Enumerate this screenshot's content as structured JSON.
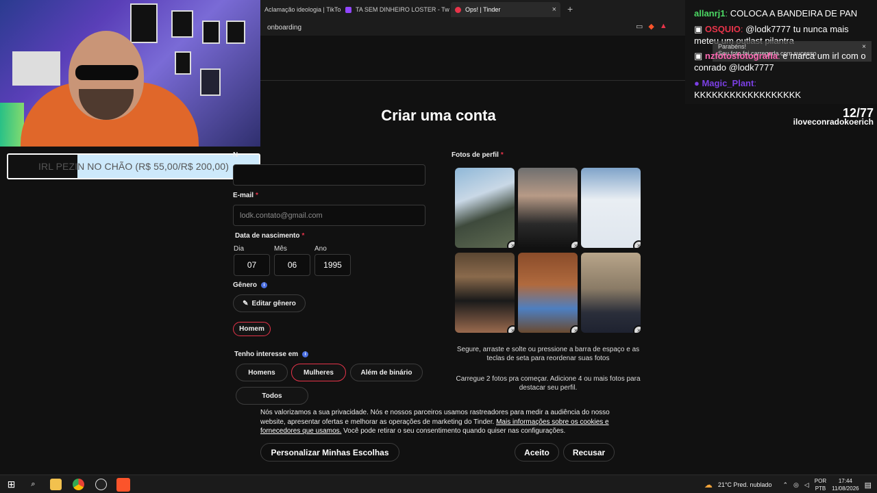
{
  "browser": {
    "tabs": [
      {
        "label": "Aclamação ideologia | TikTok",
        "color": "#ffffff",
        "active": false
      },
      {
        "label": "TA SEM DINHEIRO LOSTER - Twitch",
        "color": "#9146ff",
        "active": false
      },
      {
        "label": "Ops! | Tinder",
        "color": "#e8344a",
        "active": true
      }
    ],
    "new_tab_symbol": "+",
    "close_symbol": "×",
    "address": "onboarding"
  },
  "alert": {
    "text": "IRL PEZIN NO CHÃO (R$ 55,00/R$ 200,00)",
    "progress": 0.275,
    "fill_color": "#cde9fb"
  },
  "page": {
    "title": "Criar uma conta",
    "name_label_initial": "N",
    "email_label": "E-mail",
    "email_placeholder": "lodk.contato@gmail.com",
    "birth_label": "Data de nascimento",
    "day_label": "Dia",
    "month_label": "Mês",
    "year_label": "Ano",
    "day": "07",
    "month": "06",
    "year": "1995",
    "gender_label": "Gênero",
    "edit_gender": "Editar gênero",
    "gender_selected": "Homem",
    "interest_label": "Tenho interesse em",
    "interest_options": [
      "Homens",
      "Mulheres",
      "Além de binário",
      "Todos"
    ],
    "interest_selected": "Mulheres",
    "photos_label": "Fotos de perfil",
    "helper_1": "Segure, arraste e solte ou pressione a barra de espaço e as teclas de seta para reordenar suas fotos",
    "helper_2": "Carregue 2 fotos pra começar. Adicione 4 ou mais fotos para destacar seu perfil.",
    "required_mark": "*",
    "info_symbol": "i",
    "remove_symbol": "×",
    "edit_icon": "pencil-icon"
  },
  "cookie": {
    "text_before": "Nós valorizamos a sua privacidade. Nós e nossos parceiros usamos rastreadores para medir a audiência do nosso website, apresentar ofertas e melhorar as operações de marketing do Tinder. ",
    "link": "Mais informações sobre os cookies e fornecedores que usamos.",
    "text_after": " Você pode retirar o seu consentimento quando quiser nas configurações.",
    "personalize": "Personalizar Minhas Escolhas",
    "accept": "Aceito",
    "reject": "Recusar"
  },
  "chat": {
    "messages": [
      {
        "user": "allanrj1",
        "color": "#4cd964",
        "text": "COLOCA A BANDEIRA DE PAN"
      },
      {
        "user": "OSQUIO",
        "color": "#e8344a",
        "text": "@lodk7777 tu nunca mais meteu um outlast pilantra"
      },
      {
        "user": "nzfotosfotografia",
        "color": "#ff69b4",
        "text": "e marca um irl com o conrado @lodk7777"
      },
      {
        "user": "Magic_Plant",
        "color": "#7b3fe4",
        "text": "KKKKKKKKKKKKKKKKKK"
      }
    ],
    "popup_title": "Parabéns!",
    "popup_text": "Seu foto foi carregada com sucesso",
    "counter": "12/77",
    "counter_name": "iloveconradokoerich"
  },
  "taskbar": {
    "weather": "21°C  Pred. nublado",
    "lang_1": "POR",
    "lang_2": "PTB",
    "time": "17:44",
    "date": "11/08/2026",
    "icons": [
      "windows-start-icon",
      "search-icon",
      "file-explorer-icon",
      "chrome-icon",
      "obs-icon",
      "brave-icon"
    ]
  }
}
